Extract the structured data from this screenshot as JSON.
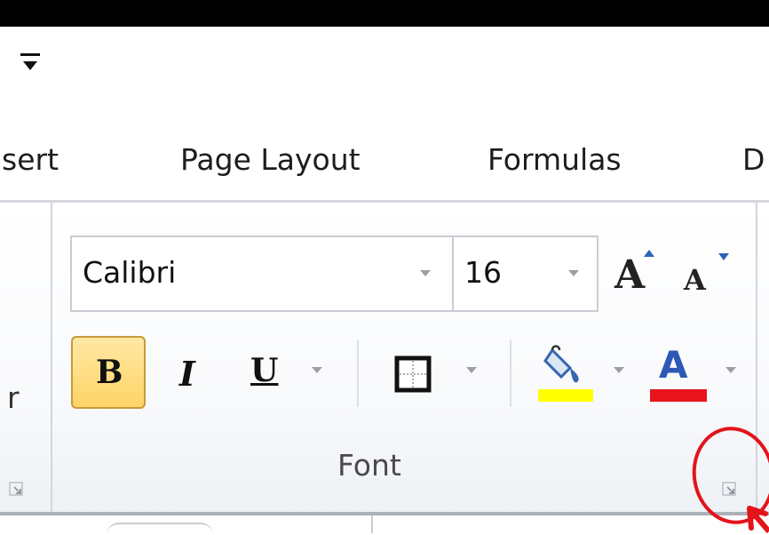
{
  "tabs": [
    {
      "label": "sert"
    },
    {
      "label": "Page Layout"
    },
    {
      "label": "Formulas"
    },
    {
      "label": "D"
    }
  ],
  "font_group": {
    "font_name": "Calibri",
    "font_size": "16",
    "grow_font_glyph": "A",
    "shrink_font_glyph": "A",
    "bold_glyph": "B",
    "italic_glyph": "I",
    "underline_glyph": "U",
    "font_color_glyph": "A",
    "label": "Font"
  },
  "left_group_stub": "r",
  "colors": {
    "highlight": "#ffff00",
    "font_color": "#e8141b",
    "bold_active_bg": "#ffd467",
    "annotation": "#e3141a"
  }
}
